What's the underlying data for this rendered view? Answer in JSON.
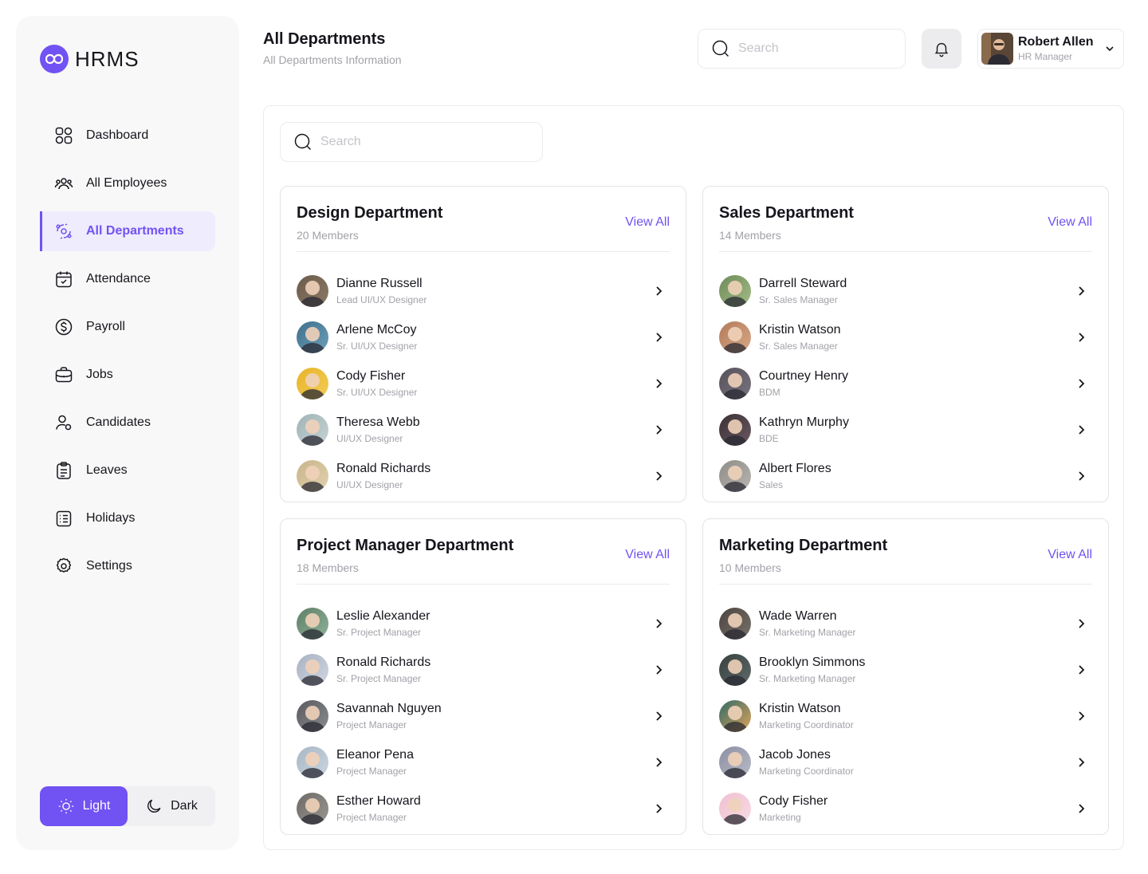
{
  "app": {
    "logo_text": "HRMS"
  },
  "sidebar": {
    "items": [
      {
        "label": "Dashboard",
        "icon": "dashboard-icon"
      },
      {
        "label": "All Employees",
        "icon": "users-icon"
      },
      {
        "label": "All Departments",
        "icon": "departments-icon",
        "active": true
      },
      {
        "label": "Attendance",
        "icon": "calendar-check-icon"
      },
      {
        "label": "Payroll",
        "icon": "dollar-icon"
      },
      {
        "label": "Jobs",
        "icon": "briefcase-icon"
      },
      {
        "label": "Candidates",
        "icon": "candidates-icon"
      },
      {
        "label": "Leaves",
        "icon": "clipboard-icon"
      },
      {
        "label": "Holidays",
        "icon": "holidays-icon"
      },
      {
        "label": "Settings",
        "icon": "settings-icon"
      }
    ],
    "theme": {
      "light_label": "Light",
      "dark_label": "Dark",
      "selected": "Light"
    }
  },
  "header": {
    "title": "All Departments",
    "subtitle": "All Departments Information",
    "search_placeholder": "Search",
    "user": {
      "name": "Robert Allen",
      "role": "HR Manager"
    }
  },
  "main": {
    "search_placeholder": "Search",
    "view_all_label": "View All",
    "departments": [
      {
        "name": "Design Department",
        "count": "20 Members",
        "members": [
          {
            "name": "Dianne Russell",
            "role": "Lead UI/UX Designer"
          },
          {
            "name": "Arlene McCoy",
            "role": "Sr. UI/UX Designer"
          },
          {
            "name": "Cody Fisher",
            "role": "Sr. UI/UX Designer"
          },
          {
            "name": "Theresa Webb",
            "role": "UI/UX Designer"
          },
          {
            "name": "Ronald Richards",
            "role": "UI/UX Designer"
          }
        ]
      },
      {
        "name": "Sales Department",
        "count": "14 Members",
        "members": [
          {
            "name": "Darrell Steward",
            "role": "Sr. Sales Manager"
          },
          {
            "name": "Kristin Watson",
            "role": "Sr. Sales Manager"
          },
          {
            "name": "Courtney Henry",
            "role": "BDM"
          },
          {
            "name": "Kathryn Murphy",
            "role": "BDE"
          },
          {
            "name": "Albert Flores",
            "role": "Sales"
          }
        ]
      },
      {
        "name": "Project Manager Department",
        "count": "18 Members",
        "members": [
          {
            "name": "Leslie Alexander",
            "role": "Sr. Project Manager"
          },
          {
            "name": "Ronald Richards",
            "role": "Sr. Project Manager"
          },
          {
            "name": "Savannah Nguyen",
            "role": "Project Manager"
          },
          {
            "name": "Eleanor Pena",
            "role": "Project Manager"
          },
          {
            "name": "Esther Howard",
            "role": "Project Manager"
          }
        ]
      },
      {
        "name": "Marketing Department",
        "count": "10 Members",
        "members": [
          {
            "name": "Wade Warren",
            "role": "Sr. Marketing Manager"
          },
          {
            "name": "Brooklyn Simmons",
            "role": "Sr. Marketing Manager"
          },
          {
            "name": "Kristin Watson",
            "role": "Marketing Coordinator"
          },
          {
            "name": "Jacob Jones",
            "role": "Marketing Coordinator"
          },
          {
            "name": "Cody Fisher",
            "role": "Marketing"
          }
        ]
      }
    ]
  },
  "colors": {
    "accent": "#7152f3",
    "text": "#16151c",
    "muted": "#a2a1a8",
    "border": "#ebebed"
  }
}
